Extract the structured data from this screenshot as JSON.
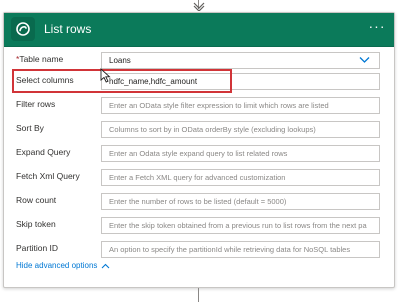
{
  "card": {
    "title": "List rows",
    "more_label": "···"
  },
  "fields": [
    {
      "key": "table_name",
      "label": "Table name",
      "required": "*",
      "value": "Loans",
      "placeholder": "",
      "type": "dropdown"
    },
    {
      "key": "select_columns",
      "label": "Select columns",
      "value": "hdfc_name,hdfc_amount",
      "placeholder": "",
      "type": "text"
    },
    {
      "key": "filter_rows",
      "label": "Filter rows",
      "value": "",
      "placeholder": "Enter an OData style filter expression to limit which rows are listed",
      "type": "text"
    },
    {
      "key": "sort_by",
      "label": "Sort By",
      "value": "",
      "placeholder": "Columns to sort by in OData orderBy style (excluding lookups)",
      "type": "text"
    },
    {
      "key": "expand_query",
      "label": "Expand Query",
      "value": "",
      "placeholder": "Enter an Odata style expand query to list related rows",
      "type": "text"
    },
    {
      "key": "fetch_xml_query",
      "label": "Fetch Xml Query",
      "value": "",
      "placeholder": "Enter a Fetch XML query for advanced customization",
      "type": "text"
    },
    {
      "key": "row_count",
      "label": "Row count",
      "value": "",
      "placeholder": "Enter the number of rows to be listed (default = 5000)",
      "type": "text"
    },
    {
      "key": "skip_token",
      "label": "Skip token",
      "value": "",
      "placeholder": "Enter the skip token obtained from a previous run to list rows from the next pa",
      "type": "text"
    },
    {
      "key": "partition_id",
      "label": "Partition ID",
      "value": "",
      "placeholder": "An option to specify the partitionId while retrieving data for NoSQL tables",
      "type": "text"
    }
  ],
  "footer": {
    "toggle_label": "Hide advanced options"
  },
  "colors": {
    "header_bg": "#0b7a5a",
    "link": "#0078d4",
    "highlight": "#d13438"
  },
  "icons": {
    "app": "dataverse-icon",
    "dropdown": "chevron-down-icon",
    "toggle": "chevron-up-icon"
  }
}
